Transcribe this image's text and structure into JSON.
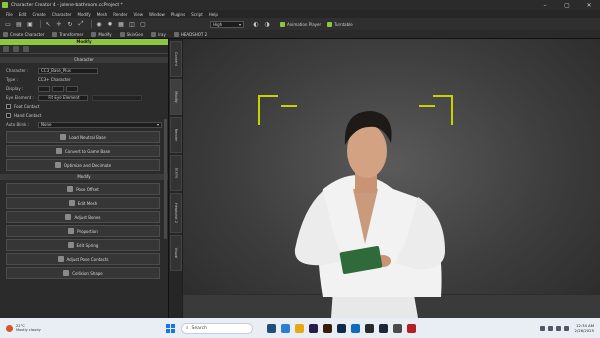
{
  "window": {
    "title": "Character Creator 4 - jolene-bathroom.ccProject *"
  },
  "menu": [
    "File",
    "Edit",
    "Create",
    "Character",
    "Modify",
    "Mesh",
    "Render",
    "View",
    "Window",
    "Plugins",
    "Script",
    "Help"
  ],
  "toolbar1": {
    "quality": "High",
    "animation_player": "Animation Player",
    "turntable": "Turntable"
  },
  "toolbar2": {
    "create_character": "Create Character",
    "transformer": "Transformer",
    "modify": "Modify",
    "skin_gen": "SkinGen",
    "iray": "Iray",
    "headshot": "HEADSHOT 2"
  },
  "panel": {
    "header": "Modify",
    "character_section": "Character",
    "character_label": "Character :",
    "character_value": "CC3_Base_Plus",
    "type_label": "Type :",
    "type_value": "CC3+ Character",
    "display_label": "Display :",
    "eye_element_label": "Eye Element :",
    "eye_element_button": "Fit Eye Element",
    "foot_contact": "Foot Contact",
    "hand_contact": "Hand Contact",
    "auto_blink_label": "Auto Blink :",
    "auto_blink_value": "None",
    "btn_load_neutral_base": "Load Neutral Base",
    "btn_convert_game_base": "Convert to Game Base",
    "btn_optimize_decimate": "Optimize and Decimate",
    "modify_section": "Modify",
    "btn_pose_offset": "Pose Offset",
    "btn_edit_mesh": "Edit Mesh",
    "btn_adjust_bones": "Adjust Bones",
    "btn_proportion": "Proportion",
    "btn_edit_spring": "Edit Spring",
    "btn_adjust_pose_contacts": "Adjust Pose Contacts",
    "btn_collision_shape": "Collision Shape"
  },
  "side_tabs": [
    "Content",
    "Modify",
    "Render",
    "Scene",
    "Headshot 2",
    "Visual"
  ],
  "taskbar": {
    "weather_line1": "22°C",
    "weather_line2": "Mostly cloudy",
    "search_placeholder": "Search",
    "time": "12:34 AM",
    "date": "2/26/2025"
  },
  "colors": {
    "accent": "#8dc63f",
    "bracket": "#c8d200",
    "taskbar": "#e9eef4"
  }
}
